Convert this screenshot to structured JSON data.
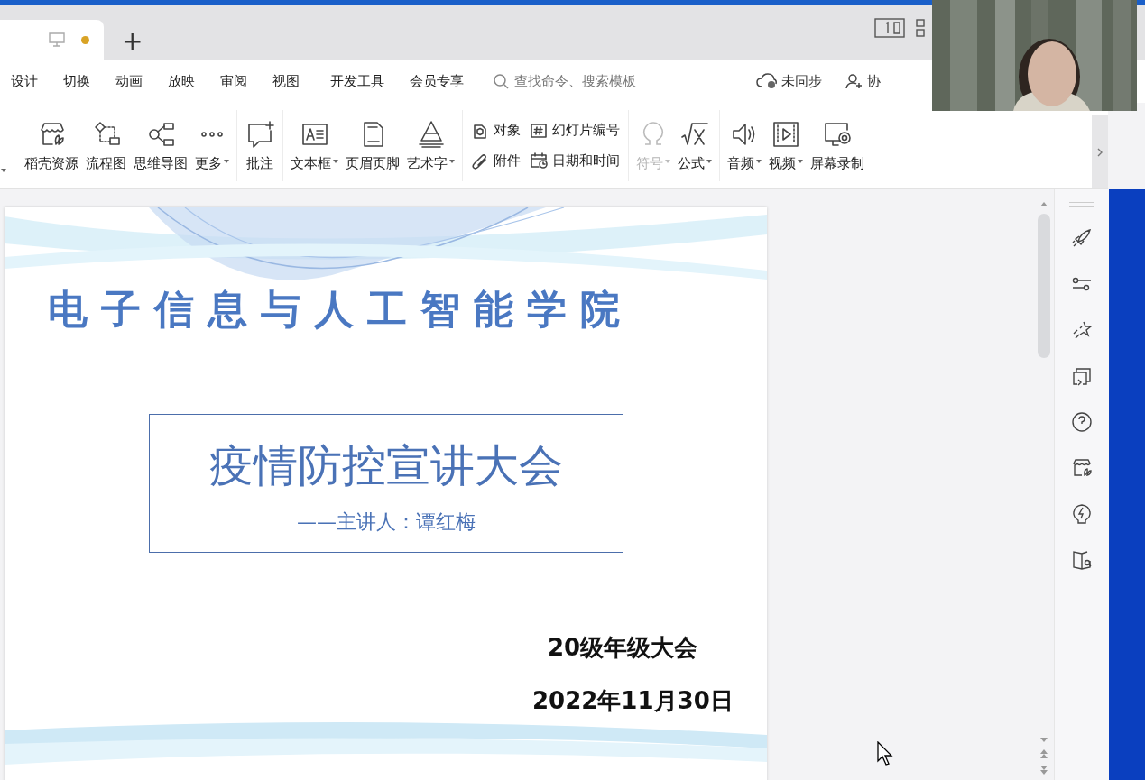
{
  "document_tab": {
    "selected": true,
    "unsaved": true
  },
  "new_tab_button": "+",
  "menu": [
    "设计",
    "切换",
    "动画",
    "放映",
    "审阅",
    "视图",
    "开发工具",
    "会员专享"
  ],
  "search": {
    "placeholder": "查找命令、搜索模板"
  },
  "sync_status": "未同步",
  "collaborate": "协",
  "ribbon": {
    "groups": [
      {
        "kind": "large",
        "items": [
          {
            "label": "稻壳资源",
            "dropdown": false,
            "disabled": false
          },
          {
            "label": "流程图",
            "dropdown": false,
            "disabled": false
          },
          {
            "label": "思维导图",
            "dropdown": false,
            "disabled": false
          },
          {
            "label": "更多",
            "dropdown": true,
            "disabled": false
          }
        ]
      },
      {
        "kind": "large",
        "items": [
          {
            "label": "批注",
            "dropdown": false,
            "disabled": false
          }
        ]
      },
      {
        "kind": "large",
        "items": [
          {
            "label": "文本框",
            "dropdown": true,
            "disabled": false
          },
          {
            "label": "页眉页脚",
            "dropdown": false,
            "disabled": false
          },
          {
            "label": "艺术字",
            "dropdown": true,
            "disabled": false
          }
        ]
      },
      {
        "kind": "small",
        "items": [
          {
            "label": "对象",
            "disabled": false
          },
          {
            "label": "附件",
            "disabled": false
          },
          {
            "label": "幻灯片编号",
            "disabled": false
          },
          {
            "label": "日期和时间",
            "disabled": false
          }
        ]
      },
      {
        "kind": "large",
        "items": [
          {
            "label": "符号",
            "dropdown": true,
            "disabled": true
          },
          {
            "label": "公式",
            "dropdown": true,
            "disabled": false
          }
        ]
      },
      {
        "kind": "large",
        "items": [
          {
            "label": "音频",
            "dropdown": true,
            "disabled": false
          },
          {
            "label": "视频",
            "dropdown": true,
            "disabled": false
          },
          {
            "label": "屏幕录制",
            "dropdown": false,
            "disabled": false
          }
        ]
      }
    ]
  },
  "slide": {
    "title": "电子信息与人工智能学院",
    "headline": "疫情防控宣讲大会",
    "speaker": "——主讲人：谭红梅",
    "meeting": "20级年级大会",
    "date": "2022年11月30日"
  }
}
